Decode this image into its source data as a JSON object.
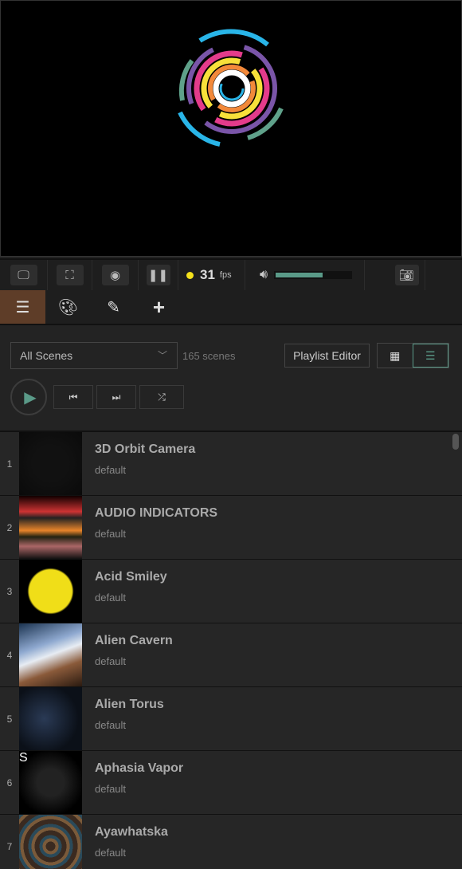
{
  "toolbar": {
    "fps": "31",
    "fps_unit": "fps",
    "volume_percent": 60
  },
  "tabs": [
    {
      "name": "scenes",
      "icon": "list-icon",
      "active": true
    },
    {
      "name": "palette",
      "icon": "palette-icon"
    },
    {
      "name": "edit",
      "icon": "pencil-icon"
    },
    {
      "name": "add",
      "icon": "plus-icon"
    }
  ],
  "controls": {
    "filter": "All Scenes",
    "count": "165 scenes",
    "playlist_editor": "Playlist Editor"
  },
  "scenes": [
    {
      "num": "1",
      "name": "3D Orbit Camera",
      "sub": "default"
    },
    {
      "num": "2",
      "name": "AUDIO INDICATORS",
      "sub": "default"
    },
    {
      "num": "3",
      "name": "Acid Smiley",
      "sub": "default"
    },
    {
      "num": "4",
      "name": "Alien Cavern",
      "sub": "default"
    },
    {
      "num": "5",
      "name": "Alien Torus",
      "sub": "default"
    },
    {
      "num": "6",
      "name": "Aphasia Vapor",
      "sub": "default"
    },
    {
      "num": "7",
      "name": "Ayawhatska",
      "sub": "default"
    }
  ],
  "colors": {
    "accent": "#5a9a88",
    "active_tab": "#5e3d28",
    "fps_dot": "#f5e11b"
  }
}
